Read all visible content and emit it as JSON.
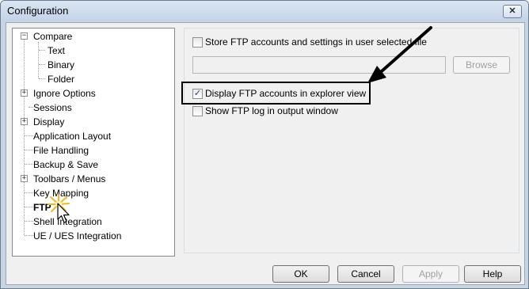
{
  "window": {
    "title": "Configuration",
    "close_label": "✕"
  },
  "tree": {
    "items": [
      {
        "label": "Compare",
        "expander": "−"
      },
      {
        "label": "Text"
      },
      {
        "label": "Binary"
      },
      {
        "label": "Folder"
      },
      {
        "label": "Ignore Options",
        "expander": "+"
      },
      {
        "label": "Sessions"
      },
      {
        "label": "Display",
        "expander": "+"
      },
      {
        "label": "Application Layout"
      },
      {
        "label": "File Handling"
      },
      {
        "label": "Backup & Save"
      },
      {
        "label": "Toolbars / Menus",
        "expander": "+"
      },
      {
        "label": "Key Mapping"
      },
      {
        "label": "FTP"
      },
      {
        "label": "Shell Integration"
      },
      {
        "label": "UE / UES Integration"
      }
    ]
  },
  "ftp": {
    "store_label": "Store FTP accounts and settings in user selected file",
    "store_checked": false,
    "path_value": "",
    "browse_label": "Browse",
    "display_label": "Display FTP accounts in explorer view",
    "display_checked": true,
    "display_check_glyph": "✓",
    "log_label": "Show FTP log in output window",
    "log_checked": false
  },
  "buttons": {
    "ok": "OK",
    "cancel": "Cancel",
    "apply": "Apply",
    "help": "Help"
  },
  "colors": {
    "accent_check": "#2a3f8f",
    "cursor_burst": "#f3b81b"
  },
  "icons": {
    "cursor": "cursor-icon",
    "arrow": "arrow-icon"
  }
}
